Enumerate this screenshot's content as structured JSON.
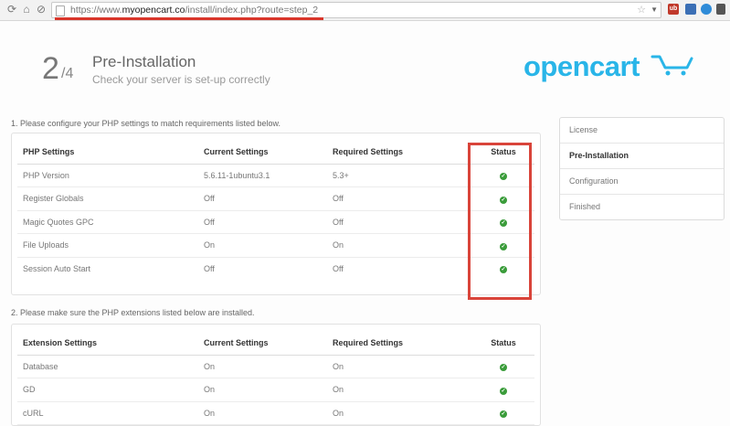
{
  "browser": {
    "url_scheme": "https://www.",
    "url_host": "myopencart.co",
    "url_path": "/install/index.php?route=step_2",
    "ext_labels": [
      "ub",
      "",
      "",
      ""
    ]
  },
  "header": {
    "step_current": "2",
    "step_total": "/4",
    "title": "Pre-Installation",
    "subtitle": "Check your server is set-up correctly",
    "logo": "opencart"
  },
  "section1": {
    "instruction": "1. Please configure your PHP settings to match requirements listed below.",
    "headers": [
      "PHP Settings",
      "Current Settings",
      "Required Settings",
      "Status"
    ],
    "rows": [
      [
        "PHP Version",
        "5.6.11-1ubuntu3.1",
        "5.3+"
      ],
      [
        "Register Globals",
        "Off",
        "Off"
      ],
      [
        "Magic Quotes GPC",
        "Off",
        "Off"
      ],
      [
        "File Uploads",
        "On",
        "On"
      ],
      [
        "Session Auto Start",
        "Off",
        "Off"
      ]
    ]
  },
  "section2": {
    "instruction": "2. Please make sure the PHP extensions listed below are installed.",
    "headers": [
      "Extension Settings",
      "Current Settings",
      "Required Settings",
      "Status"
    ],
    "rows": [
      [
        "Database",
        "On",
        "On"
      ],
      [
        "GD",
        "On",
        "On"
      ],
      [
        "cURL",
        "On",
        "On"
      ]
    ]
  },
  "sidebar": {
    "items": [
      {
        "label": "License"
      },
      {
        "label": "Pre-Installation"
      },
      {
        "label": "Configuration"
      },
      {
        "label": "Finished"
      }
    ]
  },
  "status_icon": "check-circle-icon",
  "colors": {
    "accent": "#29b5e8",
    "highlight": "#d9443a",
    "ok": "#3a9c3a"
  }
}
